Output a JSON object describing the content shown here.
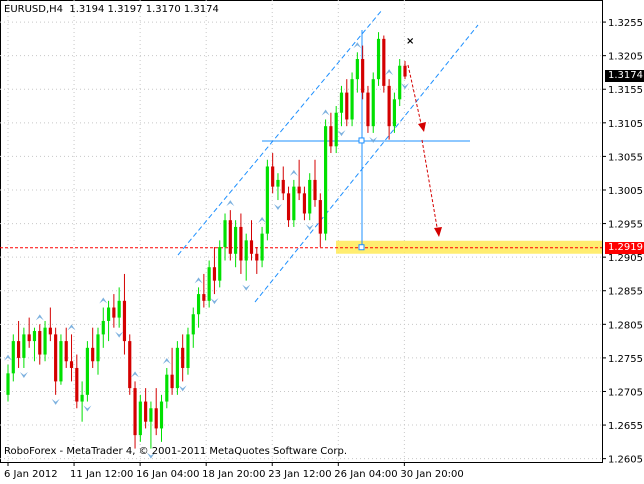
{
  "window": {
    "header": "EURUSD,H4  1.3194 1.3197 1.3170 1.3174",
    "footer": "RoboForex - MetaTrader 4, © 2001-2011 MetaQuotes Software Corp."
  },
  "colors": {
    "bull": "#00e000",
    "bear": "#d40000",
    "grid": "#c8c8c8",
    "channel": "#1e90ff",
    "level": "#1e90ff",
    "support": "#ff0000",
    "zone": "#ffea57",
    "fractal": "#6fa8dc",
    "forecast": "#d40000",
    "tag_current": "#000000",
    "tag_target": "#ff0000"
  },
  "tags": {
    "current": "1.3174",
    "target": "1.2919"
  },
  "chart_data": {
    "type": "candlestick",
    "symbol": "EURUSD",
    "timeframe": "H4",
    "ohlc_last": {
      "open": 1.3194,
      "high": 1.3197,
      "low": 1.317,
      "close": 1.3174
    },
    "y_ticks": [
      1.3255,
      1.3205,
      1.3155,
      1.3105,
      1.3055,
      1.3005,
      1.2955,
      1.2905,
      1.2855,
      1.2805,
      1.2755,
      1.2705,
      1.2655,
      1.2605
    ],
    "ylim": [
      1.26,
      1.327
    ],
    "x_ticks": [
      "6 Jan 2012",
      "11 Jan 12:00",
      "16 Jan 04:00",
      "18 Jan 20:00",
      "23 Jan 12:00",
      "26 Jan 04:00",
      "30 Jan 20:00"
    ],
    "x_tick_bar_index": [
      0,
      16,
      32,
      48,
      64,
      80,
      96
    ],
    "current_price": 1.3174,
    "target_price": 1.2919,
    "horizontal_level": 1.3078,
    "series": [
      {
        "values": [
          [
            1.27,
            1.2745,
            1.269,
            1.2732
          ],
          [
            1.2732,
            1.279,
            1.272,
            1.278
          ],
          [
            1.278,
            1.281,
            1.274,
            1.2755
          ],
          [
            1.2755,
            1.28,
            1.274,
            1.279
          ],
          [
            1.279,
            1.2815,
            1.277,
            1.278
          ],
          [
            1.278,
            1.28,
            1.275,
            1.2795
          ],
          [
            1.2795,
            1.2805,
            1.2745,
            1.276
          ],
          [
            1.276,
            1.281,
            1.275,
            1.28
          ],
          [
            1.28,
            1.283,
            1.278,
            1.279
          ],
          [
            1.279,
            1.28,
            1.27,
            1.272
          ],
          [
            1.272,
            1.279,
            1.2715,
            1.278
          ],
          [
            1.278,
            1.28,
            1.274,
            1.275
          ],
          [
            1.275,
            1.279,
            1.272,
            1.274
          ],
          [
            1.274,
            1.276,
            1.268,
            1.269
          ],
          [
            1.269,
            1.272,
            1.266,
            1.27
          ],
          [
            1.27,
            1.278,
            1.269,
            1.277
          ],
          [
            1.277,
            1.28,
            1.274,
            1.275
          ],
          [
            1.275,
            1.28,
            1.273,
            1.279
          ],
          [
            1.279,
            1.283,
            1.277,
            1.281
          ],
          [
            1.281,
            1.284,
            1.278,
            1.283
          ],
          [
            1.283,
            1.285,
            1.28,
            1.2815
          ],
          [
            1.2815,
            1.286,
            1.28,
            1.284
          ],
          [
            1.284,
            1.288,
            1.276,
            1.278
          ],
          [
            1.278,
            1.279,
            1.27,
            1.271
          ],
          [
            1.271,
            1.272,
            1.262,
            1.264
          ],
          [
            1.264,
            1.27,
            1.263,
            1.269
          ],
          [
            1.269,
            1.271,
            1.265,
            1.266
          ],
          [
            1.266,
            1.269,
            1.262,
            1.268
          ],
          [
            1.268,
            1.271,
            1.264,
            1.265
          ],
          [
            1.265,
            1.27,
            1.263,
            1.269
          ],
          [
            1.269,
            1.274,
            1.268,
            1.273
          ],
          [
            1.273,
            1.277,
            1.27,
            1.271
          ],
          [
            1.271,
            1.278,
            1.27,
            1.277
          ],
          [
            1.277,
            1.279,
            1.272,
            1.274
          ],
          [
            1.274,
            1.28,
            1.273,
            1.279
          ],
          [
            1.279,
            1.283,
            1.277,
            1.282
          ],
          [
            1.282,
            1.286,
            1.28,
            1.285
          ],
          [
            1.285,
            1.288,
            1.283,
            1.284
          ],
          [
            1.284,
            1.29,
            1.283,
            1.289
          ],
          [
            1.289,
            1.292,
            1.285,
            1.287
          ],
          [
            1.287,
            1.293,
            1.286,
            1.292
          ],
          [
            1.292,
            1.297,
            1.29,
            1.296
          ],
          [
            1.296,
            1.2975,
            1.29,
            1.291
          ],
          [
            1.291,
            1.296,
            1.289,
            1.295
          ],
          [
            1.295,
            1.297,
            1.288,
            1.29
          ],
          [
            1.29,
            1.294,
            1.287,
            1.293
          ],
          [
            1.293,
            1.296,
            1.29,
            1.291
          ],
          [
            1.291,
            1.292,
            1.288,
            1.29
          ],
          [
            1.29,
            1.295,
            1.289,
            1.294
          ],
          [
            1.294,
            1.305,
            1.293,
            1.304
          ],
          [
            1.304,
            1.306,
            1.3,
            1.301
          ],
          [
            1.301,
            1.303,
            1.299,
            1.302
          ],
          [
            1.302,
            1.304,
            1.299,
            1.3
          ],
          [
            1.3,
            1.301,
            1.295,
            1.296
          ],
          [
            1.296,
            1.302,
            1.295,
            1.301
          ],
          [
            1.301,
            1.305,
            1.299,
            1.3
          ],
          [
            1.3,
            1.301,
            1.296,
            1.297
          ],
          [
            1.297,
            1.303,
            1.296,
            1.302
          ],
          [
            1.302,
            1.305,
            1.298,
            1.299
          ],
          [
            1.299,
            1.3,
            1.292,
            1.294
          ],
          [
            1.294,
            1.311,
            1.293,
            1.31
          ],
          [
            1.31,
            1.312,
            1.306,
            1.307
          ],
          [
            1.307,
            1.313,
            1.306,
            1.312
          ],
          [
            1.312,
            1.316,
            1.31,
            1.315
          ],
          [
            1.315,
            1.317,
            1.31,
            1.311
          ],
          [
            1.311,
            1.318,
            1.31,
            1.317
          ],
          [
            1.317,
            1.321,
            1.315,
            1.32
          ],
          [
            1.32,
            1.322,
            1.314,
            1.315
          ],
          [
            1.315,
            1.316,
            1.309,
            1.31
          ],
          [
            1.31,
            1.318,
            1.309,
            1.317
          ],
          [
            1.317,
            1.324,
            1.316,
            1.323
          ],
          [
            1.323,
            1.3235,
            1.315,
            1.316
          ],
          [
            1.316,
            1.317,
            1.308,
            1.31
          ],
          [
            1.31,
            1.315,
            1.309,
            1.314
          ],
          [
            1.314,
            1.32,
            1.313,
            1.319
          ],
          [
            1.319,
            1.3197,
            1.317,
            1.3174
          ]
        ]
      }
    ],
    "annotations": [
      "cross-marker",
      "forecast-arrows",
      "ascending-channel",
      "target-zone"
    ]
  }
}
